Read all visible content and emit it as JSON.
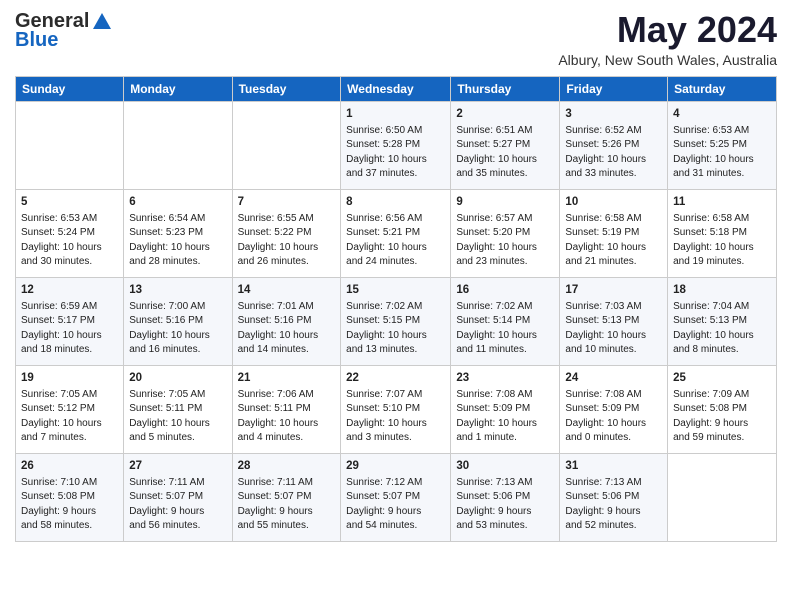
{
  "header": {
    "logo_line1": "General",
    "logo_line2": "Blue",
    "title": "May 2024",
    "subtitle": "Albury, New South Wales, Australia"
  },
  "weekdays": [
    "Sunday",
    "Monday",
    "Tuesday",
    "Wednesday",
    "Thursday",
    "Friday",
    "Saturday"
  ],
  "weeks": [
    [
      {
        "day": "",
        "info": ""
      },
      {
        "day": "",
        "info": ""
      },
      {
        "day": "",
        "info": ""
      },
      {
        "day": "1",
        "info": "Sunrise: 6:50 AM\nSunset: 5:28 PM\nDaylight: 10 hours\nand 37 minutes."
      },
      {
        "day": "2",
        "info": "Sunrise: 6:51 AM\nSunset: 5:27 PM\nDaylight: 10 hours\nand 35 minutes."
      },
      {
        "day": "3",
        "info": "Sunrise: 6:52 AM\nSunset: 5:26 PM\nDaylight: 10 hours\nand 33 minutes."
      },
      {
        "day": "4",
        "info": "Sunrise: 6:53 AM\nSunset: 5:25 PM\nDaylight: 10 hours\nand 31 minutes."
      }
    ],
    [
      {
        "day": "5",
        "info": "Sunrise: 6:53 AM\nSunset: 5:24 PM\nDaylight: 10 hours\nand 30 minutes."
      },
      {
        "day": "6",
        "info": "Sunrise: 6:54 AM\nSunset: 5:23 PM\nDaylight: 10 hours\nand 28 minutes."
      },
      {
        "day": "7",
        "info": "Sunrise: 6:55 AM\nSunset: 5:22 PM\nDaylight: 10 hours\nand 26 minutes."
      },
      {
        "day": "8",
        "info": "Sunrise: 6:56 AM\nSunset: 5:21 PM\nDaylight: 10 hours\nand 24 minutes."
      },
      {
        "day": "9",
        "info": "Sunrise: 6:57 AM\nSunset: 5:20 PM\nDaylight: 10 hours\nand 23 minutes."
      },
      {
        "day": "10",
        "info": "Sunrise: 6:58 AM\nSunset: 5:19 PM\nDaylight: 10 hours\nand 21 minutes."
      },
      {
        "day": "11",
        "info": "Sunrise: 6:58 AM\nSunset: 5:18 PM\nDaylight: 10 hours\nand 19 minutes."
      }
    ],
    [
      {
        "day": "12",
        "info": "Sunrise: 6:59 AM\nSunset: 5:17 PM\nDaylight: 10 hours\nand 18 minutes."
      },
      {
        "day": "13",
        "info": "Sunrise: 7:00 AM\nSunset: 5:16 PM\nDaylight: 10 hours\nand 16 minutes."
      },
      {
        "day": "14",
        "info": "Sunrise: 7:01 AM\nSunset: 5:16 PM\nDaylight: 10 hours\nand 14 minutes."
      },
      {
        "day": "15",
        "info": "Sunrise: 7:02 AM\nSunset: 5:15 PM\nDaylight: 10 hours\nand 13 minutes."
      },
      {
        "day": "16",
        "info": "Sunrise: 7:02 AM\nSunset: 5:14 PM\nDaylight: 10 hours\nand 11 minutes."
      },
      {
        "day": "17",
        "info": "Sunrise: 7:03 AM\nSunset: 5:13 PM\nDaylight: 10 hours\nand 10 minutes."
      },
      {
        "day": "18",
        "info": "Sunrise: 7:04 AM\nSunset: 5:13 PM\nDaylight: 10 hours\nand 8 minutes."
      }
    ],
    [
      {
        "day": "19",
        "info": "Sunrise: 7:05 AM\nSunset: 5:12 PM\nDaylight: 10 hours\nand 7 minutes."
      },
      {
        "day": "20",
        "info": "Sunrise: 7:05 AM\nSunset: 5:11 PM\nDaylight: 10 hours\nand 5 minutes."
      },
      {
        "day": "21",
        "info": "Sunrise: 7:06 AM\nSunset: 5:11 PM\nDaylight: 10 hours\nand 4 minutes."
      },
      {
        "day": "22",
        "info": "Sunrise: 7:07 AM\nSunset: 5:10 PM\nDaylight: 10 hours\nand 3 minutes."
      },
      {
        "day": "23",
        "info": "Sunrise: 7:08 AM\nSunset: 5:09 PM\nDaylight: 10 hours\nand 1 minute."
      },
      {
        "day": "24",
        "info": "Sunrise: 7:08 AM\nSunset: 5:09 PM\nDaylight: 10 hours\nand 0 minutes."
      },
      {
        "day": "25",
        "info": "Sunrise: 7:09 AM\nSunset: 5:08 PM\nDaylight: 9 hours\nand 59 minutes."
      }
    ],
    [
      {
        "day": "26",
        "info": "Sunrise: 7:10 AM\nSunset: 5:08 PM\nDaylight: 9 hours\nand 58 minutes."
      },
      {
        "day": "27",
        "info": "Sunrise: 7:11 AM\nSunset: 5:07 PM\nDaylight: 9 hours\nand 56 minutes."
      },
      {
        "day": "28",
        "info": "Sunrise: 7:11 AM\nSunset: 5:07 PM\nDaylight: 9 hours\nand 55 minutes."
      },
      {
        "day": "29",
        "info": "Sunrise: 7:12 AM\nSunset: 5:07 PM\nDaylight: 9 hours\nand 54 minutes."
      },
      {
        "day": "30",
        "info": "Sunrise: 7:13 AM\nSunset: 5:06 PM\nDaylight: 9 hours\nand 53 minutes."
      },
      {
        "day": "31",
        "info": "Sunrise: 7:13 AM\nSunset: 5:06 PM\nDaylight: 9 hours\nand 52 minutes."
      },
      {
        "day": "",
        "info": ""
      }
    ]
  ]
}
